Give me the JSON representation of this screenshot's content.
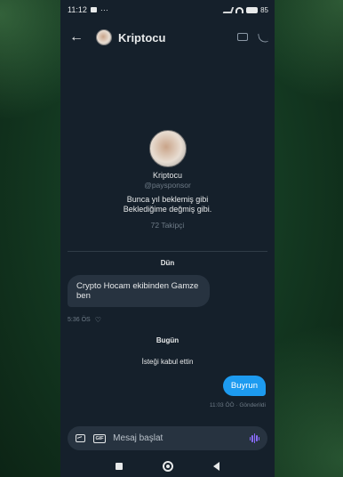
{
  "status_bar": {
    "time": "11:12",
    "extra": "···",
    "battery": "85"
  },
  "header": {
    "title": "Kriptocu"
  },
  "profile": {
    "name": "Kriptocu",
    "handle": "@paysponsor",
    "bio_line1": "Bunca yıl beklemiş gibi",
    "bio_line2": "Beklediğime değmiş gibi.",
    "followers": "72 Takipçi"
  },
  "messages": {
    "day1": "Dün",
    "incoming_text": "Crypto Hocam ekibinden Gamze ben",
    "incoming_time": "5:36 ÖS",
    "day2": "Bugün",
    "system_text": "İsteği kabul ettin",
    "outgoing_text": "Buyrun",
    "outgoing_meta": "11:03 ÖÖ · Gönderildi"
  },
  "composer": {
    "placeholder": "Mesaj başlat",
    "gif_label": "GIF"
  },
  "colors": {
    "background": "#15202b",
    "accent": "#1d9bf0",
    "bubble_in": "#273340",
    "voice": "#8a6cff"
  }
}
